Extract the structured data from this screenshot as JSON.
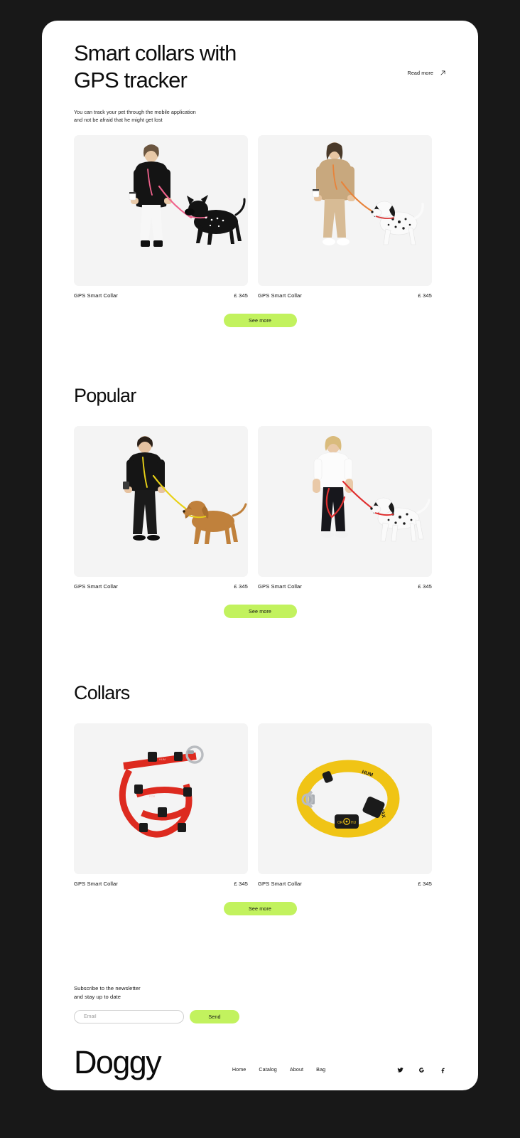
{
  "theme": {
    "page_background": "#181818",
    "card_background": "#ffffff",
    "accent_lime": "#c2f25e",
    "thumb_background": "#f4f4f4",
    "text_primary": "#0d0d0d"
  },
  "hero": {
    "title_line1": "Smart collars with",
    "title_line2": "GPS tracker",
    "subtitle_line1": "You can track your pet through the mobile application",
    "subtitle_line2": "and not be afraid that he might get lost",
    "read_more_label": "Read more",
    "read_more_icon": "arrow-up-right-icon"
  },
  "sections": [
    {
      "id": "smart-collars",
      "title": "",
      "see_more_label": "See more",
      "products": [
        {
          "name": "GPS Smart Collar",
          "price": "£ 345",
          "image": "woman-black-sweater-with-black-dog"
        },
        {
          "name": "GPS Smart Collar",
          "price": "£ 345",
          "image": "woman-beige-outfit-with-dalmatian"
        }
      ]
    },
    {
      "id": "popular",
      "title": "Popular",
      "see_more_label": "See more",
      "products": [
        {
          "name": "GPS Smart Collar",
          "price": "£ 345",
          "image": "man-black-outfit-with-vizsla-dog"
        },
        {
          "name": "GPS Smart Collar",
          "price": "£ 345",
          "image": "woman-white-tee-with-dalmatian"
        }
      ]
    },
    {
      "id": "collars",
      "title": "Collars",
      "see_more_label": "See more",
      "products": [
        {
          "name": "GPS Smart Collar",
          "price": "£ 345",
          "image": "red-dog-harness"
        },
        {
          "name": "GPS Smart Collar",
          "price": "£ 345",
          "image": "yellow-dog-collar"
        }
      ]
    }
  ],
  "newsletter": {
    "heading_line1": "Subscribe to the newsletter",
    "heading_line2": "and stay up to date",
    "email_placeholder": "Email",
    "email_value": "",
    "send_label": "Send"
  },
  "footer": {
    "brand": "Doggy",
    "nav": [
      {
        "label": "Home"
      },
      {
        "label": "Catalog"
      },
      {
        "label": "About"
      },
      {
        "label": "Bag"
      }
    ],
    "socials": [
      {
        "name": "twitter-icon"
      },
      {
        "name": "google-icon"
      },
      {
        "name": "facebook-icon"
      }
    ]
  }
}
